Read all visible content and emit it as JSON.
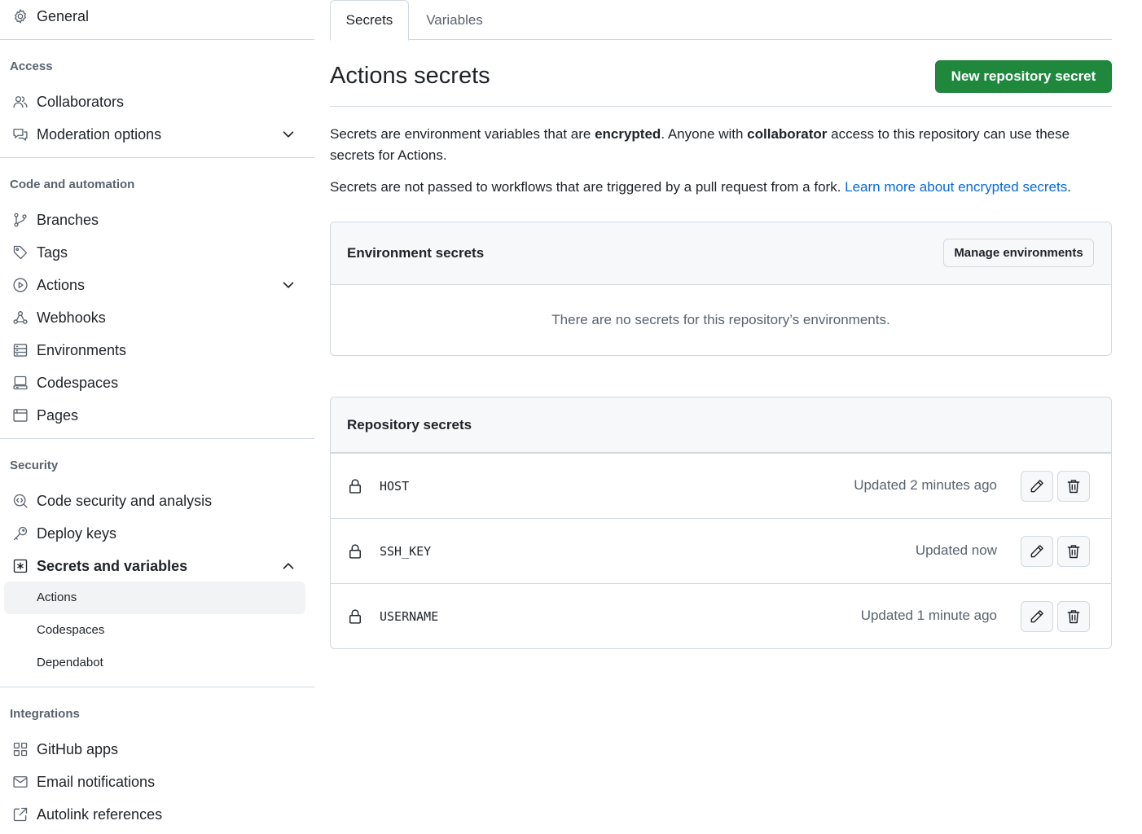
{
  "sidebar": {
    "general": "General",
    "sections": {
      "access": "Access",
      "code_automation": "Code and automation",
      "security": "Security",
      "integrations": "Integrations"
    },
    "items": {
      "collaborators": "Collaborators",
      "moderation": "Moderation options",
      "branches": "Branches",
      "tags": "Tags",
      "actions": "Actions",
      "webhooks": "Webhooks",
      "environments": "Environments",
      "codespaces": "Codespaces",
      "pages": "Pages",
      "code_security": "Code security and analysis",
      "deploy_keys": "Deploy keys",
      "secrets_variables": "Secrets and variables",
      "github_apps": "GitHub apps",
      "email_notifications": "Email notifications",
      "autolink": "Autolink references"
    },
    "sub_items": {
      "actions": "Actions",
      "codespaces": "Codespaces",
      "dependabot": "Dependabot"
    }
  },
  "tabs": {
    "secrets": "Secrets",
    "variables": "Variables"
  },
  "main": {
    "title": "Actions secrets",
    "new_secret_button": "New repository secret",
    "desc1": {
      "p1": "Secrets are environment variables that are ",
      "b1": "encrypted",
      "p2": ". Anyone with ",
      "b2": "collaborator",
      "p3": " access to this repository can use these secrets for Actions."
    },
    "desc2": {
      "text": "Secrets are not passed to workflows that are triggered by a pull request from a fork. ",
      "link": "Learn more about encrypted secrets",
      "end": "."
    }
  },
  "env_secrets": {
    "title": "Environment secrets",
    "manage_button": "Manage environments",
    "empty": "There are no secrets for this repository’s environments."
  },
  "repo_secrets": {
    "title": "Repository secrets",
    "rows": [
      {
        "name": "HOST",
        "updated": "Updated 2 minutes ago"
      },
      {
        "name": "SSH_KEY",
        "updated": "Updated now"
      },
      {
        "name": "USERNAME",
        "updated": "Updated 1 minute ago"
      }
    ]
  },
  "colors": {
    "primary_button": "#1f883d",
    "link": "#0969da",
    "muted_text": "#59636e",
    "border": "#d1d9e0"
  }
}
